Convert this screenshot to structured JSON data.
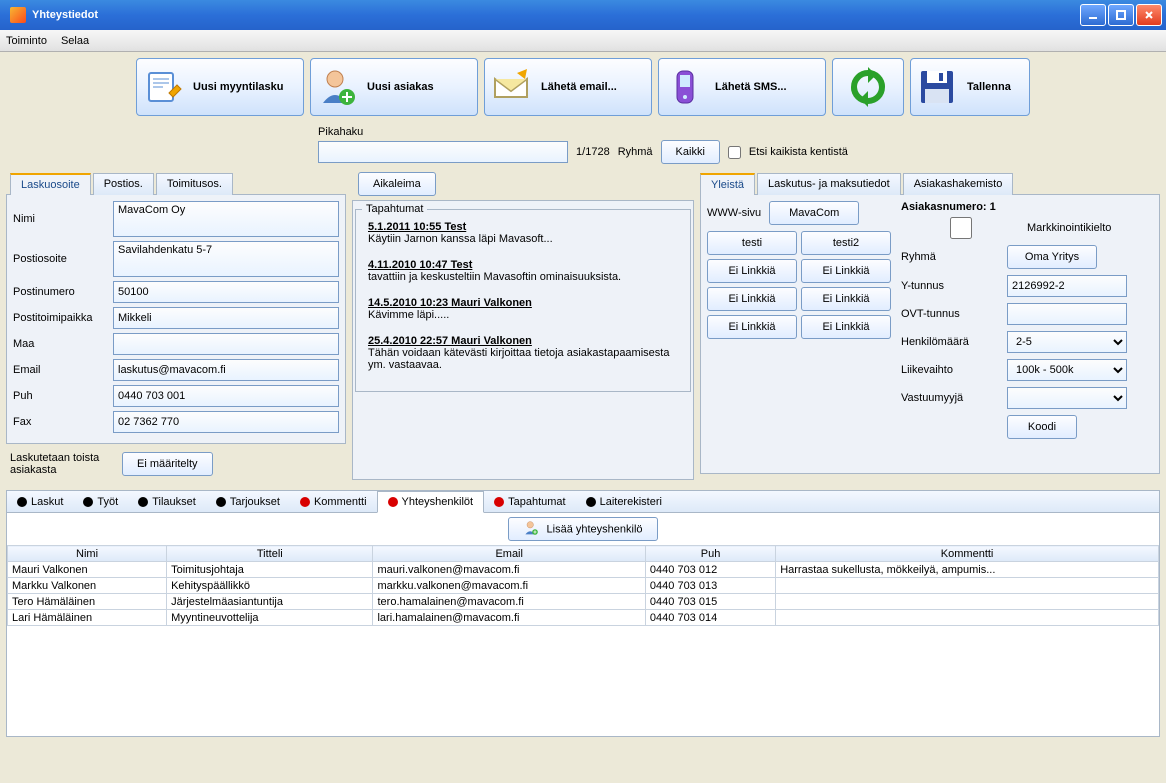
{
  "window": {
    "title": "Yhteystiedot"
  },
  "menu": {
    "toiminto": "Toiminto",
    "selaa": "Selaa"
  },
  "toolbar": {
    "uusi_lasku": "Uusi myyntilasku",
    "uusi_asiakas": "Uusi asiakas",
    "laheta_email": "Lähetä email...",
    "laheta_sms": "Lähetä SMS...",
    "tallenna": "Tallenna"
  },
  "quicksearch": {
    "label": "Pikahaku",
    "value": "",
    "counter": "1/1728",
    "ryhma_label": "Ryhmä",
    "kaikki_btn": "Kaikki",
    "etsi_chk": "Etsi kaikista kentistä"
  },
  "addr_tabs": {
    "lasku": "Laskuosoite",
    "posti": "Postios.",
    "toimitus": "Toimitusos."
  },
  "addr": {
    "nimi_l": "Nimi",
    "nimi": "MavaCom Oy",
    "posti_l": "Postiosoite",
    "posti": "Savilahdenkatu 5-7",
    "pnro_l": "Postinumero",
    "pnro": "50100",
    "ptp_l": "Postitoimipaikka",
    "ptp": "Mikkeli",
    "maa_l": "Maa",
    "maa": "",
    "email_l": "Email",
    "email": "laskutus@mavacom.fi",
    "puh_l": "Puh",
    "puh": "0440 703 001",
    "fax_l": "Fax",
    "fax": "02 7362 770",
    "bill_other": "Laskutetaan toista asiakasta",
    "bill_btn": "Ei määritelty"
  },
  "center": {
    "aikaleima": "Aikaleima",
    "tapahtumat": "Tapahtumat",
    "events": [
      {
        "head": "5.1.2011 10:55 Test",
        "body": "Käytiin Jarnon kanssa läpi Mavasoft..."
      },
      {
        "head": "4.11.2010 10:47 Test",
        "body": "tavattiin ja keskusteltiin Mavasoftin ominaisuuksista."
      },
      {
        "head": "14.5.2010 10:23 Mauri Valkonen",
        "body": "Kävimme läpi....."
      },
      {
        "head": "25.4.2010 22:57 Mauri Valkonen",
        "body": "Tähän voidaan kätevästi kirjoittaa tietoja asiakastapaamisesta ym. vastaavaa."
      }
    ]
  },
  "right_tabs": {
    "yleista": "Yleistä",
    "laskutus": "Laskutus- ja maksutiedot",
    "hakemisto": "Asiakashakemisto"
  },
  "right": {
    "www_l": "WWW-sivu",
    "links": [
      "MavaCom",
      "testi",
      "testi2",
      "Ei Linkkiä",
      "Ei Linkkiä",
      "Ei Linkkiä",
      "Ei Linkkiä",
      "Ei Linkkiä",
      "Ei Linkkiä"
    ],
    "asiakasnro": "Asiakasnumero: 1",
    "markkinointi": "Markkinointikielto",
    "ryhma_l": "Ryhmä",
    "ryhma_btn": "Oma Yritys",
    "ytunnus_l": "Y-tunnus",
    "ytunnus": "2126992-2",
    "ovt_l": "OVT-tunnus",
    "ovt": "",
    "henk_l": "Henkilömäärä",
    "henk": "2-5",
    "liike_l": "Liikevaihto",
    "liike": "100k - 500k",
    "vastuu_l": "Vastuumyyjä",
    "vastuu": "",
    "koodi_btn": "Koodi"
  },
  "btabs": {
    "laskut": "Laskut",
    "tyot": "Työt",
    "tilaukset": "Tilaukset",
    "tarjoukset": "Tarjoukset",
    "kommentti": "Kommentti",
    "yhteys": "Yhteyshenkilöt",
    "tapahtumat": "Tapahtumat",
    "laite": "Laiterekisteri"
  },
  "contacts": {
    "add_btn": "Lisää yhteyshenkilö",
    "headers": {
      "nimi": "Nimi",
      "titteli": "Titteli",
      "email": "Email",
      "puh": "Puh",
      "kommentti": "Kommentti"
    },
    "rows": [
      {
        "nimi": "Mauri Valkonen",
        "titteli": "Toimitusjohtaja",
        "email": "mauri.valkonen@mavacom.fi",
        "puh": "0440 703 012",
        "kommentti": "Harrastaa sukellusta, mökkeilyä, ampumis..."
      },
      {
        "nimi": "Markku Valkonen",
        "titteli": "Kehityspäällikkö",
        "email": "markku.valkonen@mavacom.fi",
        "puh": "0440 703 013",
        "kommentti": ""
      },
      {
        "nimi": "Tero Hämäläinen",
        "titteli": "Järjestelmäasiantuntija",
        "email": "tero.hamalainen@mavacom.fi",
        "puh": "0440 703 015",
        "kommentti": ""
      },
      {
        "nimi": "Lari Hämäläinen",
        "titteli": "Myyntineuvottelija",
        "email": "lari.hamalainen@mavacom.fi",
        "puh": "0440 703 014",
        "kommentti": ""
      }
    ]
  }
}
